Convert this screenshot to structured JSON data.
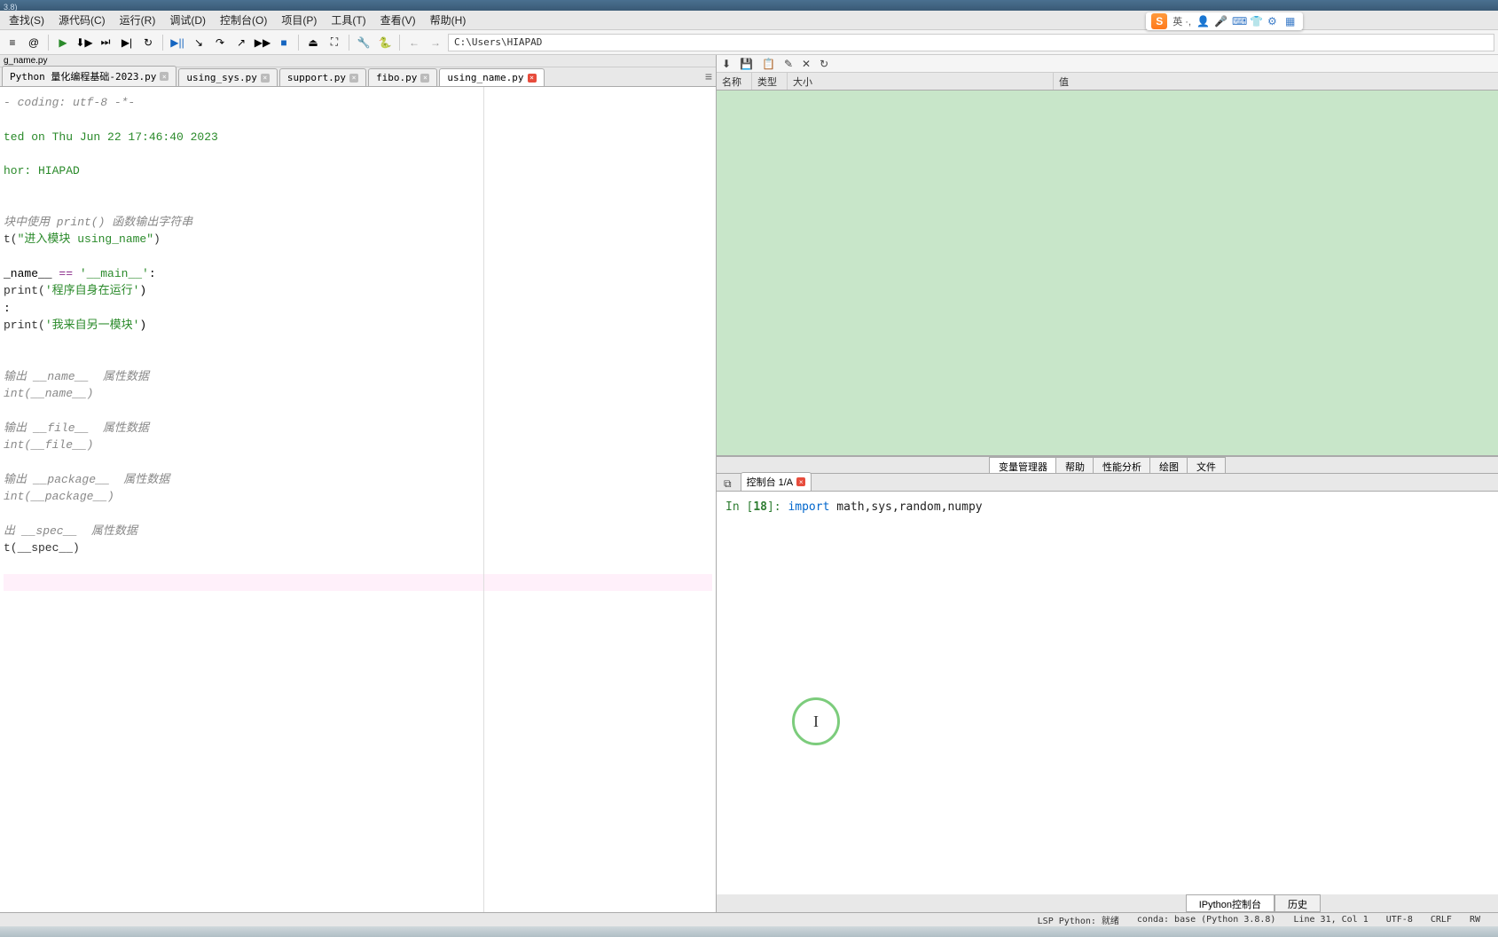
{
  "titlebar": {
    "version": "3.8)"
  },
  "menu": {
    "items": [
      "查找(S)",
      "源代码(C)",
      "运行(R)",
      "调试(D)",
      "控制台(O)",
      "项目(P)",
      "工具(T)",
      "查看(V)",
      "帮助(H)"
    ]
  },
  "toolbar": {
    "path": "C:\\Users\\HIAPAD"
  },
  "editor": {
    "header": "g_name.py",
    "tabs": [
      {
        "label": "Python 量化编程基础-2023.py",
        "active": false,
        "closeStyle": "inactive"
      },
      {
        "label": "using_sys.py",
        "active": false,
        "closeStyle": "inactive"
      },
      {
        "label": "support.py",
        "active": false,
        "closeStyle": "inactive"
      },
      {
        "label": "fibo.py",
        "active": false,
        "closeStyle": "inactive"
      },
      {
        "label": "using_name.py",
        "active": true,
        "closeStyle": "active"
      }
    ],
    "code": {
      "l1": "- coding: utf-8 -*-",
      "l3": "ted on Thu Jun 22 17:46:40 2023",
      "l5": "hor: HIAPAD",
      "l8": "块中使用 print() 函数输出字符串",
      "l9a": "t(",
      "l9b": "\"进入模块 using_name\"",
      "l9c": ")",
      "l11a": "_name__ ",
      "l11b": "==",
      "l11c": " ",
      "l11d": "'__main__'",
      "l11e": ":",
      "l12a": "print(",
      "l12b": "'程序自身在运行'",
      "l12c": ")",
      "l13": ":",
      "l14a": "print(",
      "l14b": "'我来自另一模块'",
      "l14c": ")",
      "l17": "输出 __name__  属性数据",
      "l18": "int(__name__)",
      "l20": "输出 __file__  属性数据",
      "l21": "int(__file__)",
      "l23": "输出 __package__  属性数据",
      "l24": "int(__package__)",
      "l26": "出 __spec__  属性数据",
      "l27": "t(__spec__)"
    }
  },
  "variable_explorer": {
    "columns": {
      "name": "名称",
      "type": "类型",
      "size": "大小",
      "value": "值"
    }
  },
  "right_tabs": [
    "变量管理器",
    "帮助",
    "性能分析",
    "绘图",
    "文件"
  ],
  "console": {
    "tab_label": "控制台 1/A",
    "prompt_in": "In [",
    "prompt_num": "18",
    "prompt_close": "]: ",
    "kw": "import",
    "rest": " math,sys,random,numpy",
    "cursor_glyph": "I"
  },
  "bottom_tabs": [
    "IPython控制台",
    "历史"
  ],
  "statusbar": {
    "lsp": "LSP Python: 就绪",
    "conda": "conda: base (Python 3.8.8)",
    "pos": "Line 31, Col 1",
    "enc": "UTF-8",
    "eol": "CRLF",
    "mode": "RW"
  },
  "ime": {
    "logo": "S",
    "lang": "英 ·,"
  }
}
